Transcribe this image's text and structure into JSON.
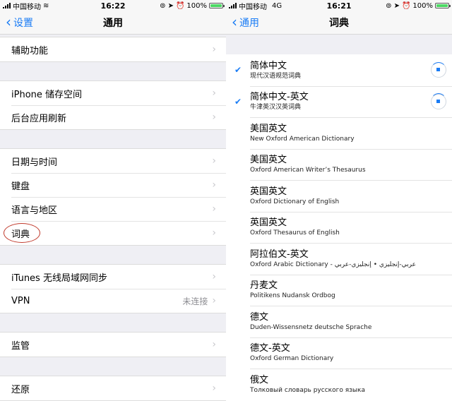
{
  "left": {
    "status": {
      "carrier": "中国移动",
      "time": "16:22",
      "battery": "100%"
    },
    "nav": {
      "back": "设置",
      "title": "通用"
    },
    "groups": [
      [
        "辅助功能"
      ],
      [
        "iPhone 储存空间",
        "后台应用刷新"
      ],
      [
        "日期与时间",
        "键盘",
        "语言与地区",
        "词典"
      ],
      [
        "iTunes 无线局域网同步",
        "VPN"
      ],
      [
        "监管"
      ],
      [
        "还原"
      ]
    ],
    "vpn_value": "未连接"
  },
  "right": {
    "status": {
      "carrier": "中国移动",
      "network": "4G",
      "time": "16:21",
      "battery": "100%"
    },
    "nav": {
      "back": "通用",
      "title": "词典"
    },
    "dictionaries": [
      {
        "name": "简体中文",
        "sub": "现代汉语规范词典",
        "checked": true,
        "downloading": true
      },
      {
        "name": "简体中文-英文",
        "sub": "牛津英汉汉英词典",
        "checked": true,
        "downloading": true
      },
      {
        "name": "美国英文",
        "sub": "New Oxford American Dictionary"
      },
      {
        "name": "美国英文",
        "sub": "Oxford American Writer’s Thesaurus"
      },
      {
        "name": "英国英文",
        "sub": "Oxford Dictionary of English"
      },
      {
        "name": "英国英文",
        "sub": "Oxford Thesaurus of English"
      },
      {
        "name": "阿拉伯文-英文",
        "sub": "Oxford Arabic Dictionary - عربي-إنجليزي • إنجليزي-عربي"
      },
      {
        "name": "丹麦文",
        "sub": "Politikens Nudansk Ordbog"
      },
      {
        "name": "德文",
        "sub": "Duden-Wissensnetz deutsche Sprache"
      },
      {
        "name": "德文-英文",
        "sub": "Oxford German Dictionary"
      },
      {
        "name": "俄文",
        "sub": "Толковый словарь русского языка"
      }
    ]
  }
}
